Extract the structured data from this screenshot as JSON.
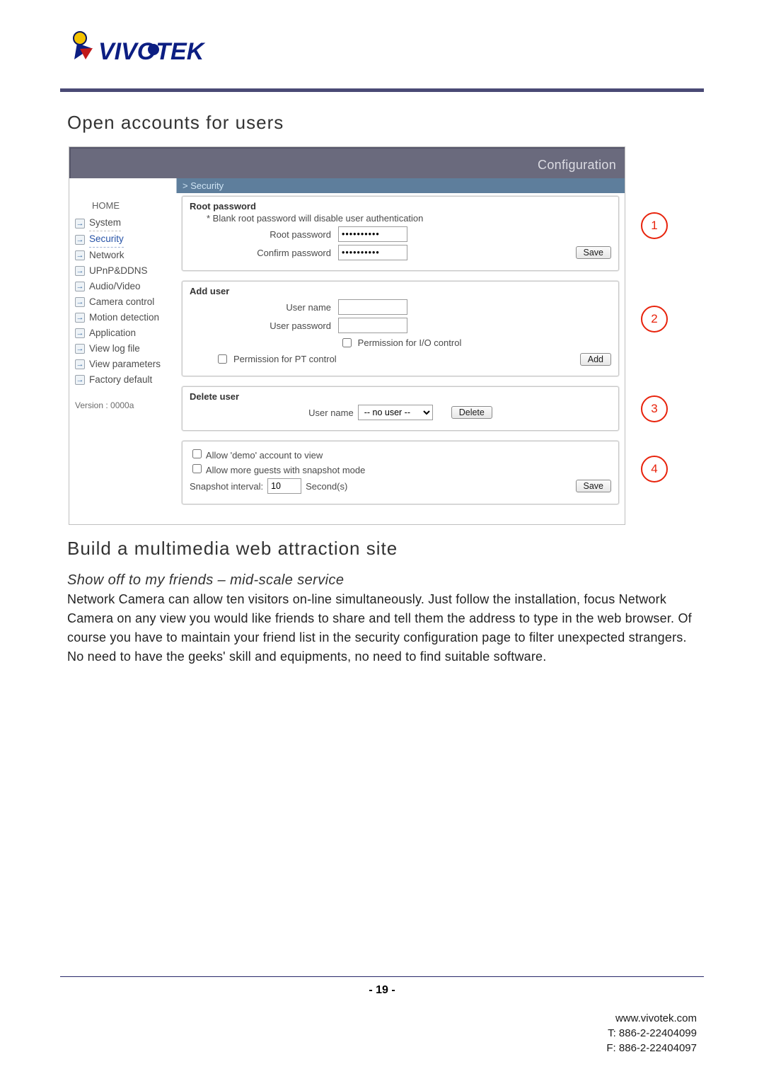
{
  "header": {
    "title": "Open accounts for users"
  },
  "config": {
    "titlebar": "Configuration",
    "breadcrumb": "> Security",
    "home": "HOME",
    "sidebar": [
      "System",
      "Security",
      "Network",
      "UPnP&DDNS",
      "Audio/Video",
      "Camera control",
      "Motion detection",
      "Application",
      "View log file",
      "View parameters",
      "Factory default"
    ],
    "version": "Version : 0000a",
    "root": {
      "legend": "Root password",
      "note": "* Blank root password will disable user authentication",
      "pw_label": "Root password",
      "cpw_label": "Confirm password",
      "pw_value": "••••••••••",
      "cpw_value": "••••••••••",
      "save": "Save"
    },
    "add": {
      "legend": "Add user",
      "name_label": "User name",
      "pw_label": "User password",
      "perm_io": "Permission for I/O control",
      "perm_pt": "Permission for PT control",
      "add": "Add"
    },
    "del": {
      "legend": "Delete user",
      "name_label": "User name",
      "select_value": "-- no user --",
      "delete": "Delete"
    },
    "opts": {
      "demo": "Allow 'demo' account to view",
      "guests": "Allow more guests with snapshot mode",
      "snap_label": "Snapshot interval:",
      "snap_value": "10",
      "snap_unit": "Second(s)",
      "save": "Save"
    },
    "markers": [
      "1",
      "2",
      "3",
      "4"
    ]
  },
  "article": {
    "title": "Build a multimedia web attraction site",
    "subhead": "Show off to my friends – mid-scale service",
    "body": "Network Camera can allow ten visitors on-line simultaneously. Just follow the installation, focus Network Camera on any view you would like friends to share and tell them the address to type in the web browser. Of course you have to maintain your friend list in the security configuration page to filter unexpected strangers. No need to have the geeks' skill and equipments, no need to find suitable software."
  },
  "footer": {
    "page": "- 19 -",
    "web": "www.vivotek.com",
    "tel": "T: 886-2-22404099",
    "fax": "F: 886-2-22404097"
  }
}
